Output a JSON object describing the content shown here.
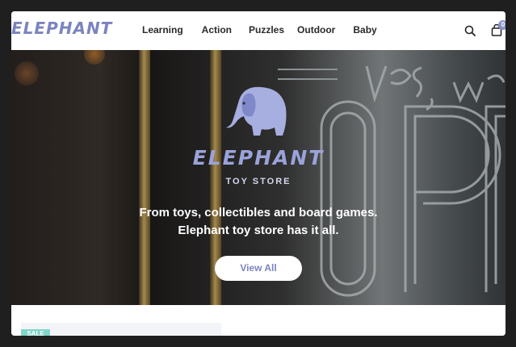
{
  "header": {
    "logo_text": "ELEPHANT",
    "nav": [
      "Learning",
      "Action",
      "Puzzles",
      "Outdoor",
      "Baby"
    ],
    "search_icon": "search-icon",
    "cart_icon": "shopping-bag-icon",
    "cart_count": "0"
  },
  "hero": {
    "logo_word": "ELEPHANT",
    "logo_sub": "TOY STORE",
    "tagline": "From toys, collectibles and board games. Elephant toy store has it all.",
    "button_label": "View All",
    "elephant_color": "#9aa3da"
  },
  "below": {
    "badge": "SALE"
  },
  "colors": {
    "brand": "#7b84bf",
    "badge": "#7fd6c9"
  }
}
